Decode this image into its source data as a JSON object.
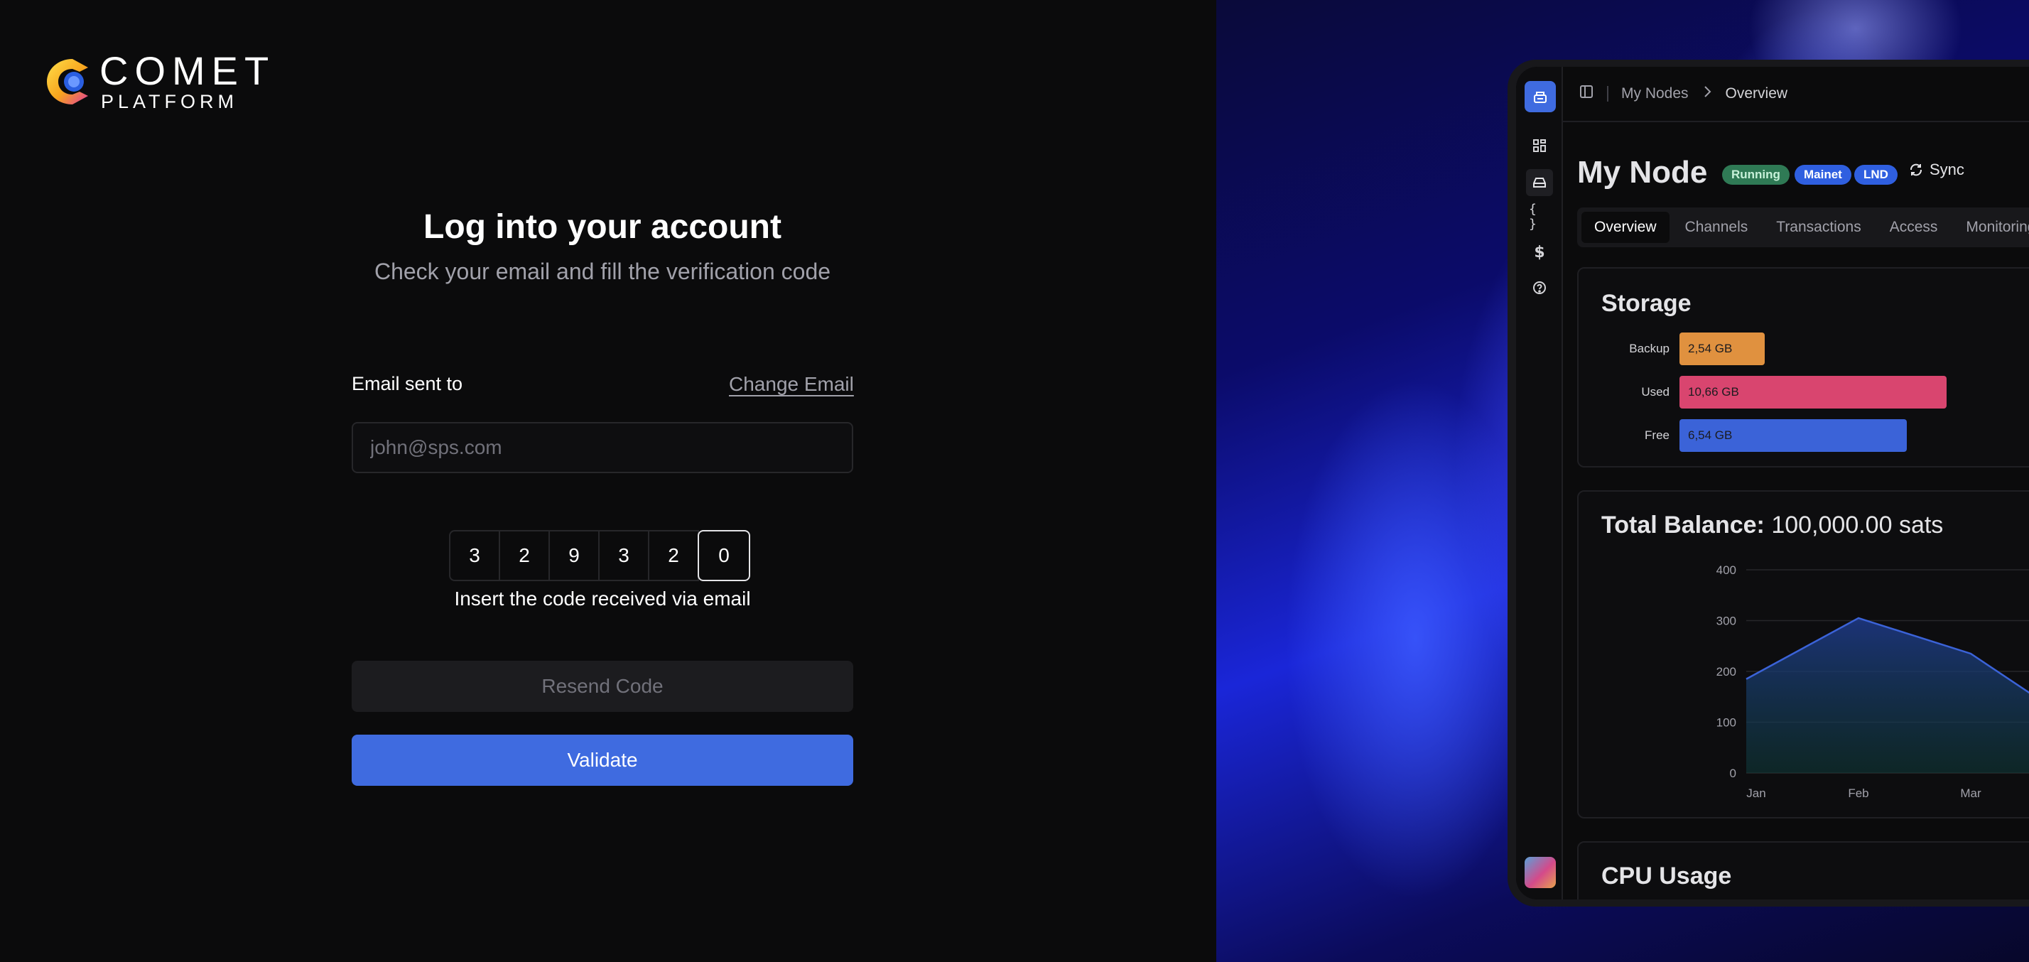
{
  "brand": {
    "title": "COMET",
    "subtitle": "PLATFORM"
  },
  "login": {
    "heading": "Log into your account",
    "subheading": "Check your email and fill the verification code",
    "email_label": "Email sent to",
    "change_email": "Change Email",
    "email_placeholder": "john@sps.com",
    "code": [
      "3",
      "2",
      "9",
      "3",
      "2",
      "0"
    ],
    "code_hint": "Insert the code received via email",
    "resend_label": "Resend Code",
    "validate_label": "Validate"
  },
  "preview": {
    "breadcrumb": [
      "My Nodes",
      "Overview"
    ],
    "node_title": "My Node",
    "badges": {
      "running": "Running",
      "mainet": "Mainet",
      "lnd": "LND"
    },
    "sync_label": "Sync",
    "tabs": [
      "Overview",
      "Channels",
      "Transactions",
      "Access",
      "Monitoring"
    ],
    "storage": {
      "title": "Storage",
      "rows": [
        {
          "label": "Backup",
          "value": "2,54 GB"
        },
        {
          "label": "Used",
          "value": "10,66 GB"
        },
        {
          "label": "Free",
          "value": "6,54 GB"
        }
      ]
    },
    "balance": {
      "label": "Total Balance:",
      "value": "100,000.00 sats"
    },
    "cpu": {
      "title": "CPU Usage"
    },
    "colors": {
      "backup": "#e0913f",
      "used": "#d9456f",
      "free": "#3b63d8",
      "accent": "#3f6be0"
    }
  },
  "chart_data": {
    "type": "area",
    "categories": [
      "Jan",
      "Feb",
      "Mar"
    ],
    "y_ticks": [
      0,
      100,
      200,
      300,
      400
    ],
    "ylim": [
      0,
      400
    ],
    "values": [
      185,
      305,
      235
    ],
    "grid": true
  }
}
